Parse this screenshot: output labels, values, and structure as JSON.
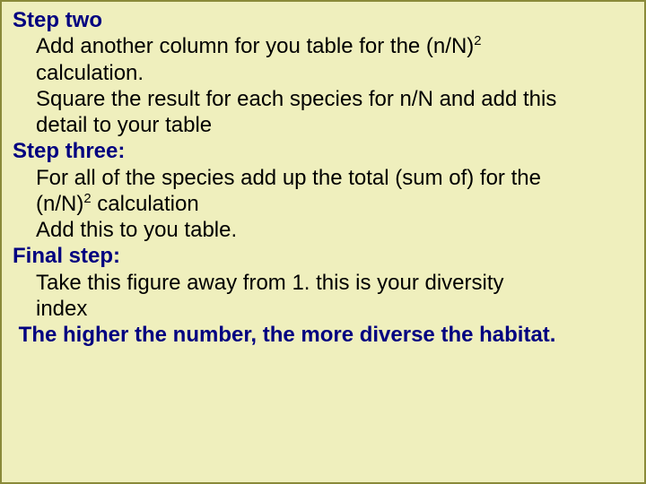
{
  "steps": {
    "s2": {
      "title": "Step two",
      "l1a": "Add another column for you table for the (n/N)",
      "l1b": "calculation.",
      "l2a": "Square the result for each species for n/N and add this",
      "l2b": "detail to your table"
    },
    "s3": {
      "title": "Step three:",
      "l1a": "For all of the species add up the total (sum of) for the",
      "l1b_a": "(n/N)",
      "l1b_b": " calculation",
      "l2": "Add this to you table."
    },
    "fs": {
      "title": "Final step:",
      "l1a": "Take this figure away from 1. this is your diversity",
      "l1b": "index"
    },
    "conclusion": " The higher the number, the more diverse the habitat.",
    "sup": "2"
  }
}
